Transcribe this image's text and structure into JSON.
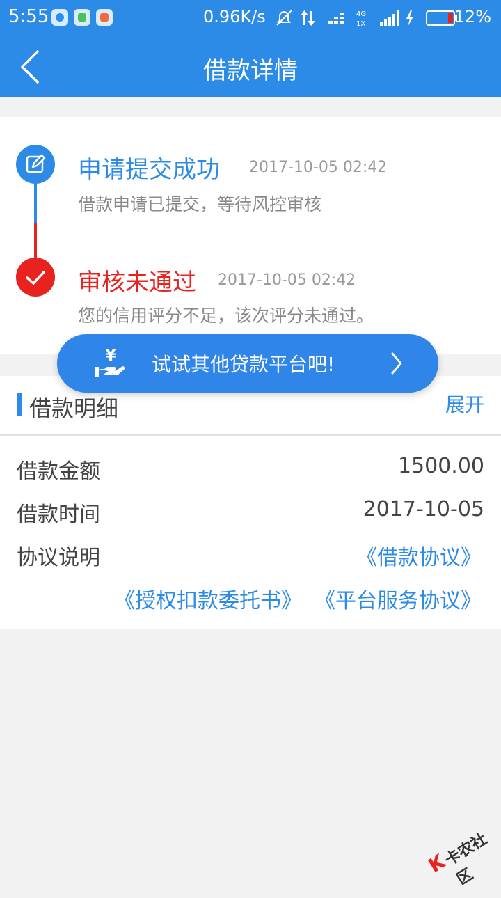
{
  "status_bar": {
    "time": "5:55",
    "network_speed": "0.96K/s",
    "network_type_top": "4G",
    "network_type_bottom": "1X",
    "battery_percent": "12%"
  },
  "nav": {
    "title": "借款详情"
  },
  "timeline": {
    "steps": [
      {
        "title": "申请提交成功",
        "time": "2017-10-05 02:42",
        "desc": "借款申请已提交，等待风控审核",
        "color": "#2b8be6"
      },
      {
        "title": "审核未通过",
        "time": "2017-10-05 02:42",
        "desc": "您的信用评分不足，该次评分未通过。",
        "color": "#e8231f"
      }
    ]
  },
  "promo": {
    "label": "试试其他贷款平台吧!",
    "icon_glyph": "¥"
  },
  "detail": {
    "title": "借款明细",
    "expand_label": "展开",
    "rows": [
      {
        "label": "借款金额",
        "value": "1500.00"
      },
      {
        "label": "借款时间",
        "value": "2017-10-05"
      },
      {
        "label": "协议说明"
      }
    ],
    "agreements": [
      "《借款协议》",
      "《授权扣款委托书》",
      "《平台服务协议》"
    ]
  },
  "watermark": {
    "k": "K",
    "text": "卡农社区"
  },
  "colors": {
    "primary": "#2b8be6",
    "danger": "#e8231f",
    "background": "#f2f2f2"
  }
}
